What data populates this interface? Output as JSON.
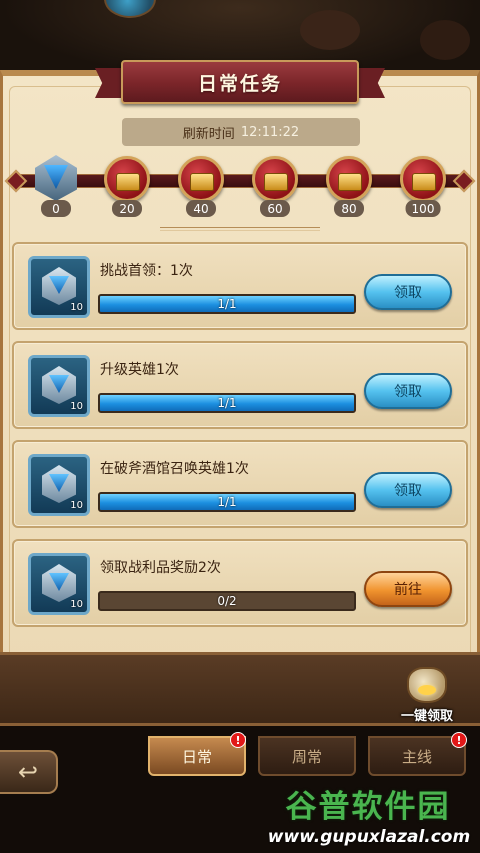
{
  "title": "日常任务",
  "refresh": {
    "label": "刷新时间",
    "time": "12:11:22"
  },
  "milestones": [
    {
      "value": "0",
      "type": "emblem"
    },
    {
      "value": "20",
      "type": "chest"
    },
    {
      "value": "40",
      "type": "chest"
    },
    {
      "value": "60",
      "type": "chest"
    },
    {
      "value": "80",
      "type": "chest"
    },
    {
      "value": "100",
      "type": "chest"
    }
  ],
  "tasks": [
    {
      "title": "挑战首领：1次",
      "progress_text": "1/1",
      "progress": 1.0,
      "reward_qty": "10",
      "button": "领取",
      "button_style": "blue"
    },
    {
      "title": "升级英雄1次",
      "progress_text": "1/1",
      "progress": 1.0,
      "reward_qty": "10",
      "button": "领取",
      "button_style": "blue"
    },
    {
      "title": "在破斧酒馆召唤英雄1次",
      "progress_text": "1/1",
      "progress": 1.0,
      "reward_qty": "10",
      "button": "领取",
      "button_style": "blue"
    },
    {
      "title": "领取战利品奖励2次",
      "progress_text": "0/2",
      "progress": 0.0,
      "reward_qty": "10",
      "button": "前往",
      "button_style": "orange"
    }
  ],
  "one_click": {
    "label": "一键领取"
  },
  "tabs": [
    {
      "label": "日常",
      "active": true,
      "badge": "!"
    },
    {
      "label": "周常",
      "active": false,
      "badge": ""
    },
    {
      "label": "主线",
      "active": false,
      "badge": "!"
    }
  ],
  "back_icon": "back-arrow-icon",
  "watermark": {
    "title": "谷普软件园",
    "url": "www.gupuxlazal.com"
  },
  "colors": {
    "progress_blue": "#1c8fe0",
    "ribbon_red": "#7a2529",
    "button_blue": "#55c2ef",
    "button_orange": "#f0932e"
  }
}
